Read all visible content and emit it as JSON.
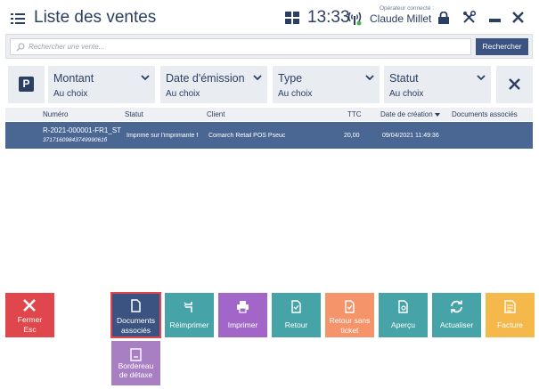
{
  "header": {
    "title": "Liste des ventes",
    "time": "13:33",
    "operator_label": "Opérateur connecté :",
    "operator_name": "Claude Millet"
  },
  "search": {
    "placeholder": "Rechercher une vente...",
    "button_label": "Rechercher"
  },
  "filters": [
    {
      "name": "Montant",
      "value": "Au choix"
    },
    {
      "name": "Date d'émission",
      "value": "Au choix"
    },
    {
      "name": "Type",
      "value": "Au choix"
    },
    {
      "name": "Statut",
      "value": "Au choix"
    }
  ],
  "table": {
    "columns": [
      "Numéro",
      "Statut",
      "Client",
      "TTC",
      "Date de création",
      "Documents associés"
    ],
    "rows": [
      {
        "numero": "R-2021-000001-FR1_ST",
        "numero_sub": "3717160984374999061б",
        "statut": "Imprimé sur l'imprimante f",
        "client": "Comarch Retail POS Pseuc",
        "ttc": "20,00",
        "date": "09/04/2021 11:49:36",
        "documents": ""
      }
    ]
  },
  "actions": [
    {
      "label": "Fermer",
      "sub": "Esc",
      "color": "#e0474c"
    },
    {
      "label": "Documents associés",
      "color": "#3b5380"
    },
    {
      "label": "Réimprimer",
      "color": "#46a3a8"
    },
    {
      "label": "Imprimer",
      "color": "#a166c7"
    },
    {
      "label": "Retour",
      "color": "#46a3a8"
    },
    {
      "label": "Retour sans ticket",
      "color": "#f5946a"
    },
    {
      "label": "Aperçu",
      "color": "#46a3a8"
    },
    {
      "label": "Actualiser",
      "color": "#46a3a8"
    },
    {
      "label": "Facture",
      "color": "#f5b84b"
    },
    {
      "label": "Bordereau de détaxe",
      "color": "#a87fc2"
    }
  ]
}
